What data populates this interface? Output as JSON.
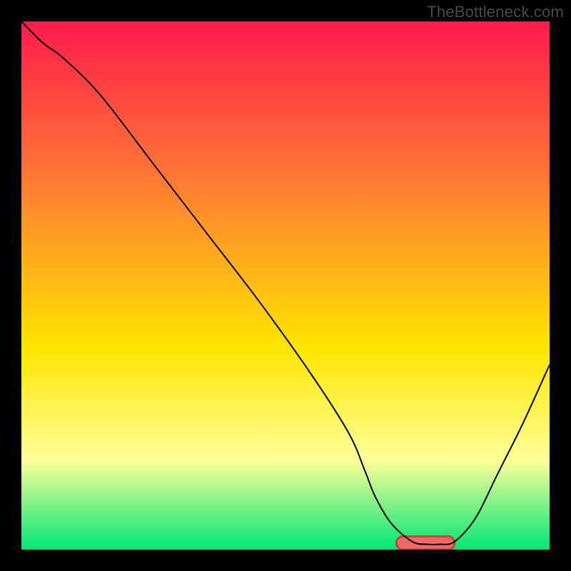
{
  "watermark": "TheBottleneck.com",
  "chart_data": {
    "type": "line",
    "title": "",
    "xlabel": "",
    "ylabel": "",
    "xlim": [
      0,
      100
    ],
    "ylim": [
      0,
      100
    ],
    "grid": false,
    "legend": false,
    "series": [
      {
        "name": "curve",
        "color": "#000000",
        "x": [
          0,
          4,
          8,
          15,
          25,
          35,
          45,
          55,
          62,
          65,
          67,
          70,
          74,
          77,
          79,
          82,
          86,
          90,
          95,
          100
        ],
        "y": [
          100,
          96,
          93,
          86,
          73,
          60,
          47,
          33,
          22,
          15,
          10,
          5,
          1.5,
          1,
          1,
          1.5,
          6,
          14,
          24,
          35
        ]
      }
    ],
    "highlight_band": {
      "name": "optimal-band",
      "color_fill": "#ed6a66",
      "color_stroke": "#d33f3b",
      "x_range": [
        71,
        82
      ],
      "y": 0,
      "height": 2.5
    },
    "background_gradient": {
      "top": "#ff1a4d",
      "mid1": "#ff7a33",
      "mid2": "#ffe600",
      "mid3": "#ffff99",
      "bottom": "#00e676"
    }
  }
}
